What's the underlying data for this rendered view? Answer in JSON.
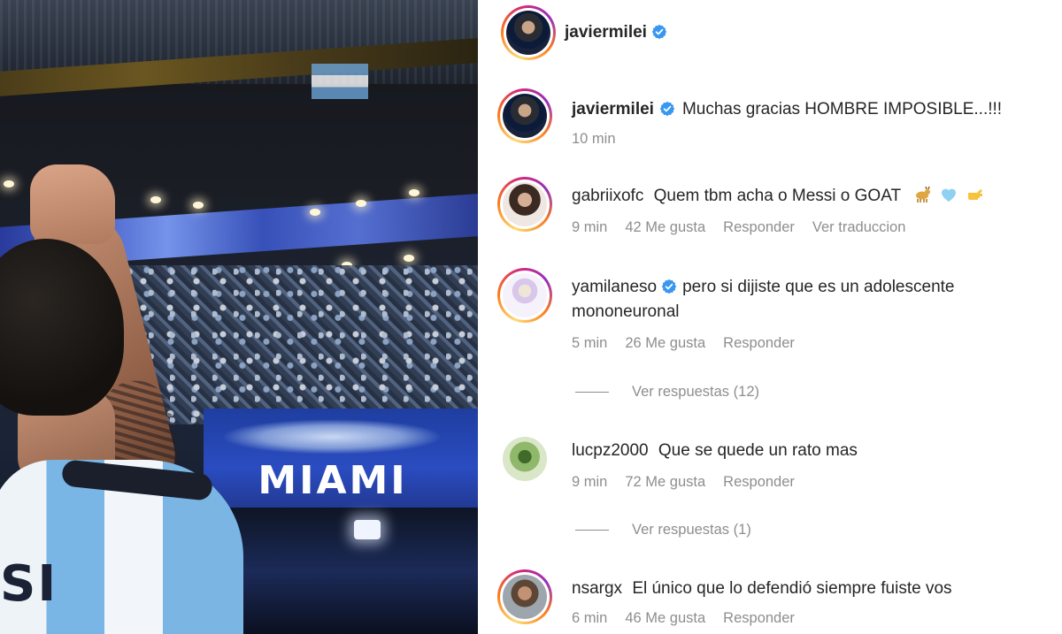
{
  "photo": {
    "banner_text": "MIAMI",
    "jersey_text": "SI"
  },
  "post": {
    "author": "javiermilei",
    "verified": true
  },
  "comments": [
    {
      "username": "javiermilei",
      "verified": true,
      "text": "Muchas gracias HOMBRE IMPOSIBLE...!!!",
      "time": "10 min"
    },
    {
      "username": "gabriixofc",
      "verified": false,
      "text": "Quem tbm acha o Messi o GOAT",
      "emojis": [
        "goat-emoji",
        "blue-heart-emoji",
        "pointing-hand-emoji"
      ],
      "time": "9 min",
      "likes": "42 Me gusta",
      "reply": "Responder",
      "translate": "Ver traduccion"
    },
    {
      "username": "yamilaneso",
      "verified": true,
      "text": "pero si dijiste que es un adolescente mononeuronal",
      "time": "5 min",
      "likes": "26 Me gusta",
      "reply": "Responder",
      "replies_label": "Ver respuestas (12)"
    },
    {
      "username": "lucpz2000",
      "verified": false,
      "text": "Que se quede un rato mas",
      "time": "9 min",
      "likes": "72 Me gusta",
      "reply": "Responder",
      "replies_label": "Ver respuestas (1)"
    },
    {
      "username": "nsargx",
      "verified": false,
      "text": "El único que lo defendió siempre fuiste vos",
      "time": "6 min",
      "likes": "46 Me gusta",
      "reply": "Responder"
    }
  ],
  "colors": {
    "verified_badge": "#3897f0",
    "meta_text": "#8e8e8e",
    "primary_text": "#262626"
  }
}
